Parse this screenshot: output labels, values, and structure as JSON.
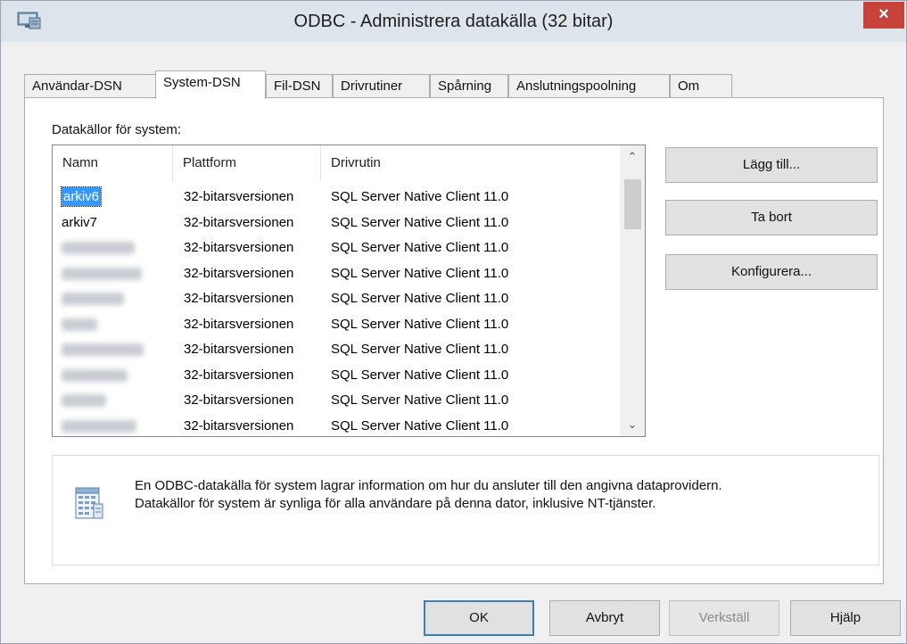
{
  "window": {
    "title": "ODBC - Administrera datakälla (32 bitar)",
    "close_symbol": "×",
    "app_icon": "odbc-admin-icon"
  },
  "tabs": [
    {
      "label": "Användar-DSN",
      "active": false
    },
    {
      "label": "System-DSN",
      "active": true
    },
    {
      "label": "Fil-DSN",
      "active": false
    },
    {
      "label": "Drivrutiner",
      "active": false
    },
    {
      "label": "Spårning",
      "active": false
    },
    {
      "label": "Anslutningspoolning",
      "active": false
    },
    {
      "label": "Om",
      "active": false
    }
  ],
  "system_dsn": {
    "section_label": "Datakällor för system:",
    "columns": {
      "name": "Namn",
      "platform": "Plattform",
      "driver": "Drivrutin"
    },
    "rows": [
      {
        "name": "arkiv6",
        "platform": "32-bitarsversionen",
        "driver": "SQL Server Native Client 11.0",
        "selected": true
      },
      {
        "name": "arkiv7",
        "platform": "32-bitarsversionen",
        "driver": "SQL Server Native Client 11.0",
        "selected": false
      },
      {
        "name": "",
        "platform": "32-bitarsversionen",
        "driver": "SQL Server Native Client 11.0",
        "selected": false
      },
      {
        "name": "",
        "platform": "32-bitarsversionen",
        "driver": "SQL Server Native Client 11.0",
        "selected": false
      },
      {
        "name": "",
        "platform": "32-bitarsversionen",
        "driver": "SQL Server Native Client 11.0",
        "selected": false
      },
      {
        "name": "",
        "platform": "32-bitarsversionen",
        "driver": "SQL Server Native Client 11.0",
        "selected": false
      },
      {
        "name": "",
        "platform": "32-bitarsversionen",
        "driver": "SQL Server Native Client 11.0",
        "selected": false
      },
      {
        "name": "",
        "platform": "32-bitarsversionen",
        "driver": "SQL Server Native Client 11.0",
        "selected": false
      },
      {
        "name": "",
        "platform": "32-bitarsversionen",
        "driver": "SQL Server Native Client 11.0",
        "selected": false
      },
      {
        "name": "",
        "platform": "32-bitarsversionen",
        "driver": "SQL Server Native Client 11.0",
        "selected": false
      }
    ],
    "buttons": {
      "add": "Lägg till...",
      "remove": "Ta bort",
      "configure": "Konfigurera..."
    },
    "info": {
      "line1": "En ODBC-datakälla för system lagrar information om hur du ansluter till den angivna dataprovidern.",
      "line2": "Datakällor för system är synliga för alla användare på denna dator, inklusive NT-tjänster.",
      "icon": "data-source-icon"
    }
  },
  "footer": {
    "ok": "OK",
    "cancel": "Avbryt",
    "apply": "Verkställ",
    "help": "Hjälp"
  },
  "colors": {
    "selection": "#3399ff",
    "close_button": "#c7423a",
    "titlebar": "#dde4ec"
  }
}
